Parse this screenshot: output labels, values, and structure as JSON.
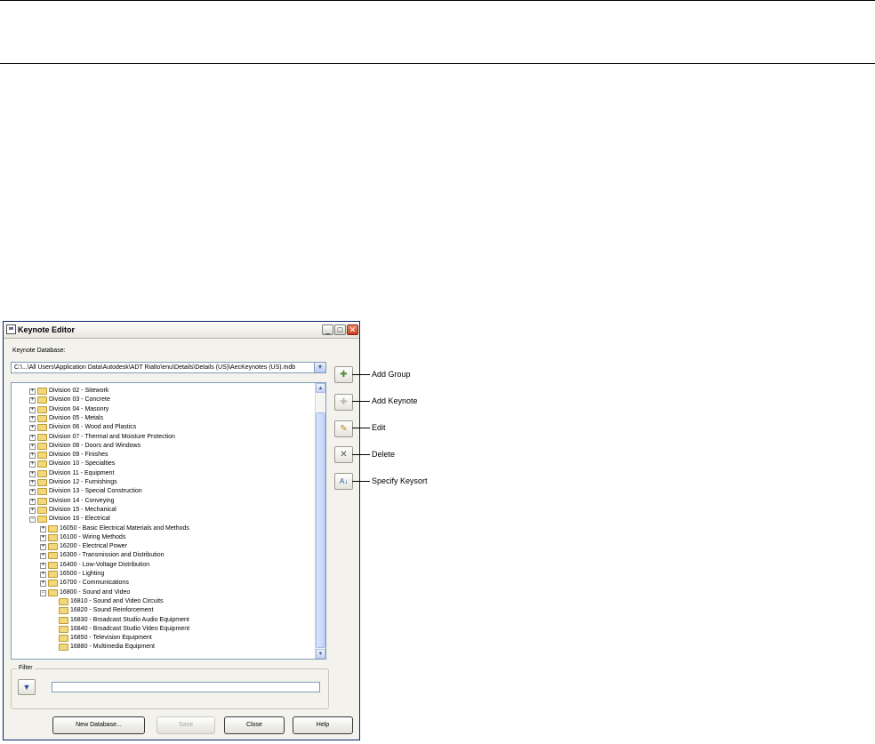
{
  "window": {
    "title": "Keynote Editor"
  },
  "database": {
    "label": "Keynote Database:",
    "path": "C:\\...\\All Users\\Application Data\\Autodesk\\ADT Rialto\\enu\\Details\\Details (US)\\AecKeynotes (US).mdb"
  },
  "tree": {
    "divisions": [
      "Division 02 - Sitework",
      "Division 03 - Concrete",
      "Division 04 - Masonry",
      "Division 05 - Metals",
      "Division 06 - Wood and Plastics",
      "Division 07 - Thermal and Moisture Protection",
      "Division 08 - Doors and Windows",
      "Division 09 - Finishes",
      "Division 10 - Specialties",
      "Division 11 - Equipment",
      "Division 12 - Furnishings",
      "Division 13 - Special Construction",
      "Division 14 - Conveying",
      "Division 15 - Mechanical",
      "Division 16 - Electrical"
    ],
    "sections": [
      "16050 - Basic Electrical Materials and Methods",
      "16100 - Wiring Methods",
      "16200 - Electrical Power",
      "16300 - Transmission and Distribution",
      "16400 - Low-Voltage Distribution",
      "16500 - Lighting",
      "16700 - Communications",
      "16800 - Sound and Video"
    ],
    "subsections": [
      "16810 - Sound and Video Circuits",
      "16820 - Sound Reinforcement",
      "16830 - Broadcast Studio Audio Equipment",
      "16840 - Broadcast Studio Video Equipment",
      "16850 - Television Equipment",
      "16880 - Multimedia Equipment"
    ]
  },
  "filter": {
    "label": "Filter",
    "value": ""
  },
  "buttons": {
    "new_database": "New Database...",
    "save": "Save",
    "close": "Close",
    "help": "Help"
  },
  "callouts": {
    "add_group": "Add Group",
    "add_keynote": "Add Keynote",
    "edit": "Edit",
    "delete": "Delete",
    "specify_keysort": "Specify Keysort"
  }
}
